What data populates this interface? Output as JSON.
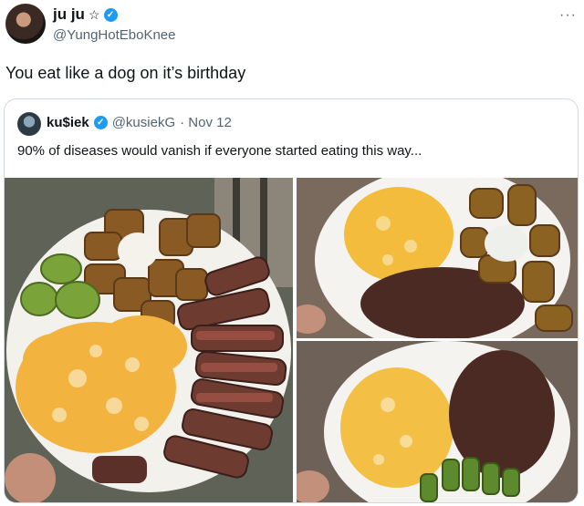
{
  "tweet": {
    "display_name": "ju ju",
    "name_emoji": "☆",
    "handle": "@YungHotEboKnee",
    "more": "···",
    "text": "You eat like a dog on it’s birthday"
  },
  "quoted_tweet": {
    "display_name": "ku$iek",
    "handle": "@kusiekG",
    "date": "· Nov 12",
    "text": "90% of diseases would vanish if everyone started eating this way...",
    "photos": [
      "steak-eggs-avocado-potatoes-plate",
      "eggs-beef-potatoes-plate",
      "eggs-beef-pickles-plate"
    ]
  },
  "icons": {
    "verified": "verified-badge-icon",
    "more": "more-options-icon"
  },
  "colors": {
    "verified_blue": "#1d9bf0",
    "secondary_text": "#536471",
    "border": "#cfd9de"
  }
}
